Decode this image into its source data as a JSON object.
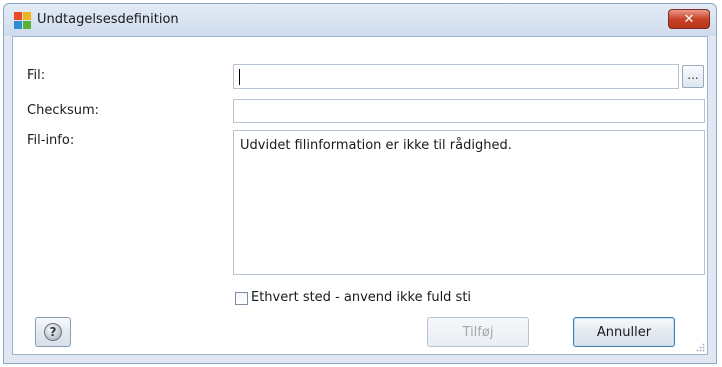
{
  "window": {
    "title": "Undtagelsesdefinition",
    "close_label": "✕"
  },
  "form": {
    "file_label": "Fil:",
    "file_value": "",
    "browse_label": "...",
    "checksum_label": "Checksum:",
    "checksum_value": "",
    "fileinfo_label": "Fil-info:",
    "fileinfo_text": "Udvidet filinformation er ikke til rådighed.",
    "anywhere_label": "Ethvert sted - anvend ikke fuld sti",
    "anywhere_checked": false
  },
  "buttons": {
    "help_label": "?",
    "add_label": "Tilføj",
    "cancel_label": "Annuller"
  },
  "icons": {
    "app": "avg-logo-icon",
    "help": "help-icon"
  }
}
